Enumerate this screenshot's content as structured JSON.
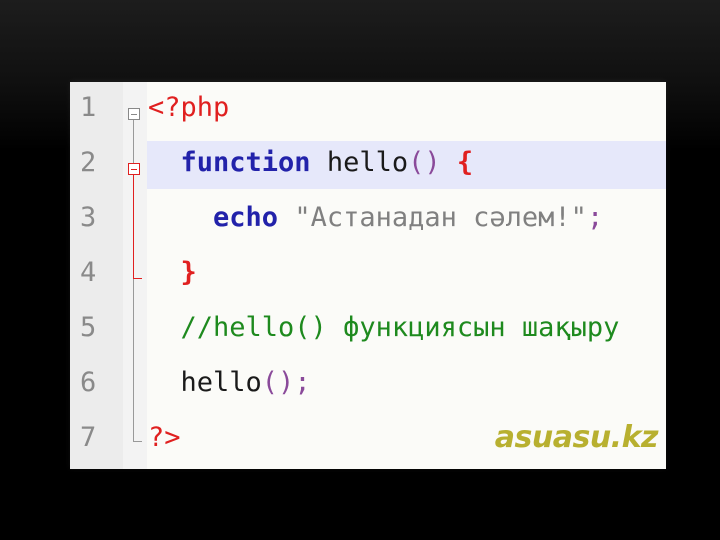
{
  "editor": {
    "lines": [
      {
        "number": "1",
        "open_tag": "<?php"
      },
      {
        "number": "2",
        "keyword": "function",
        "name": "hello",
        "paren": "()",
        "brace": "{"
      },
      {
        "number": "3",
        "keyword": "echo",
        "string": "\"Астанадан сәлем!\"",
        "semi": ";"
      },
      {
        "number": "4",
        "brace": "}"
      },
      {
        "number": "5",
        "comment": "//hello() функциясын шақыру"
      },
      {
        "number": "6",
        "name": "hello",
        "paren": "()",
        "semi": ";"
      },
      {
        "number": "7",
        "close_tag": "?>"
      }
    ],
    "watermark": "asuasu.kz"
  },
  "colors": {
    "keyword": "#2222aa",
    "tag": "#e02020",
    "string": "#808080",
    "comment": "#1e8a1e",
    "highlight": "#e6e8fa",
    "watermark": "#b8b030"
  }
}
